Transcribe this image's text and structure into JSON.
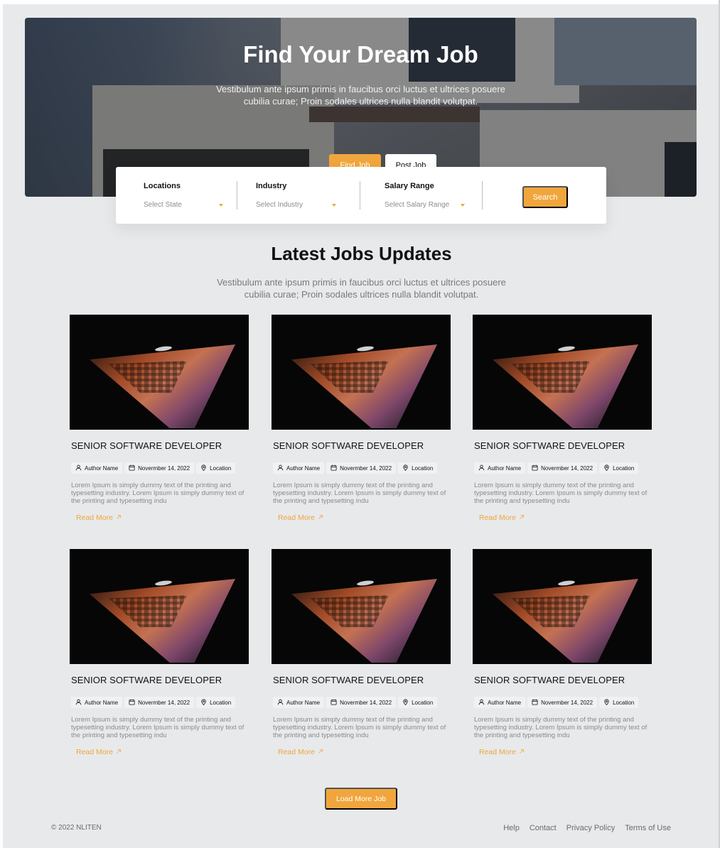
{
  "hero": {
    "title": "Find Your Dream Job",
    "subtitle": "Vestibulum ante ipsum primis in faucibus orci luctus et ultrices posuere cubilia curae; Proin sodales ultrices nulla blandit volutpat.",
    "tabs": {
      "find": "Find Job",
      "post": "Post Job"
    }
  },
  "search": {
    "locations_label": "Locations",
    "locations_value": "Select State",
    "industry_label": "Industry",
    "industry_value": "Select Industry",
    "salary_label": "Salary Range",
    "salary_value": "Select Salary Range",
    "button": "Search"
  },
  "latest": {
    "title": "Latest Jobs Updates",
    "subtitle": "Vestibulum ante ipsum primis in faucibus orci luctus et ultrices posuere cubilia curae; Proin sodales ultrices nulla blandit volutpat."
  },
  "jobs": [
    {
      "title": "SENIOR SOFTWARE DEVELOPER",
      "author": "Author Name",
      "date": "Novermber 14, 2022",
      "location": "Location",
      "description": "Lorem Ipsum is simply dummy text of the printing and typesetting industry. Lorem Ipsum is simply dummy text of the printing and typesetting indu",
      "read_more": "Read More"
    },
    {
      "title": "SENIOR SOFTWARE DEVELOPER",
      "author": "Author Name",
      "date": "Novermber 14, 2022",
      "location": "Location",
      "description": "Lorem Ipsum is simply dummy text of the printing and typesetting industry. Lorem Ipsum is simply dummy text of the printing and typesetting indu",
      "read_more": "Read More"
    },
    {
      "title": "SENIOR SOFTWARE DEVELOPER",
      "author": "Author Name",
      "date": "Novermber 14, 2022",
      "location": "Location",
      "description": "Lorem Ipsum is simply dummy text of the printing and typesetting industry. Lorem Ipsum is simply dummy text of the printing and typesetting indu",
      "read_more": "Read More"
    },
    {
      "title": "SENIOR SOFTWARE DEVELOPER",
      "author": "Author Name",
      "date": "Novermber 14, 2022",
      "location": "Location",
      "description": "Lorem Ipsum is simply dummy text of the printing and typesetting industry. Lorem Ipsum is simply dummy text of the printing and typesetting indu",
      "read_more": "Read More"
    },
    {
      "title": "SENIOR SOFTWARE DEVELOPER",
      "author": "Author Name",
      "date": "Novermber 14, 2022",
      "location": "Location",
      "description": "Lorem Ipsum is simply dummy text of the printing and typesetting industry. Lorem Ipsum is simply dummy text of the printing and typesetting indu",
      "read_more": "Read More"
    },
    {
      "title": "SENIOR SOFTWARE DEVELOPER",
      "author": "Author Name",
      "date": "Novermber 14, 2022",
      "location": "Location",
      "description": "Lorem Ipsum is simply dummy text of the printing and typesetting industry. Lorem Ipsum is simply dummy text of the printing and typesetting indu",
      "read_more": "Read More"
    }
  ],
  "load_more": "Load More Job",
  "footer": {
    "copyright": "© 2022 NLITEN",
    "links": [
      "Help",
      "Contact",
      "Privacy Policy",
      "Terms of Use"
    ]
  },
  "colors": {
    "accent": "#f0a63c",
    "page_bg": "#e8e9eb"
  },
  "icons": {
    "author": "user-icon",
    "date": "calendar-icon",
    "location": "map-pin-icon",
    "read_more": "arrow-up-right-icon",
    "select": "caret-down-icon"
  }
}
